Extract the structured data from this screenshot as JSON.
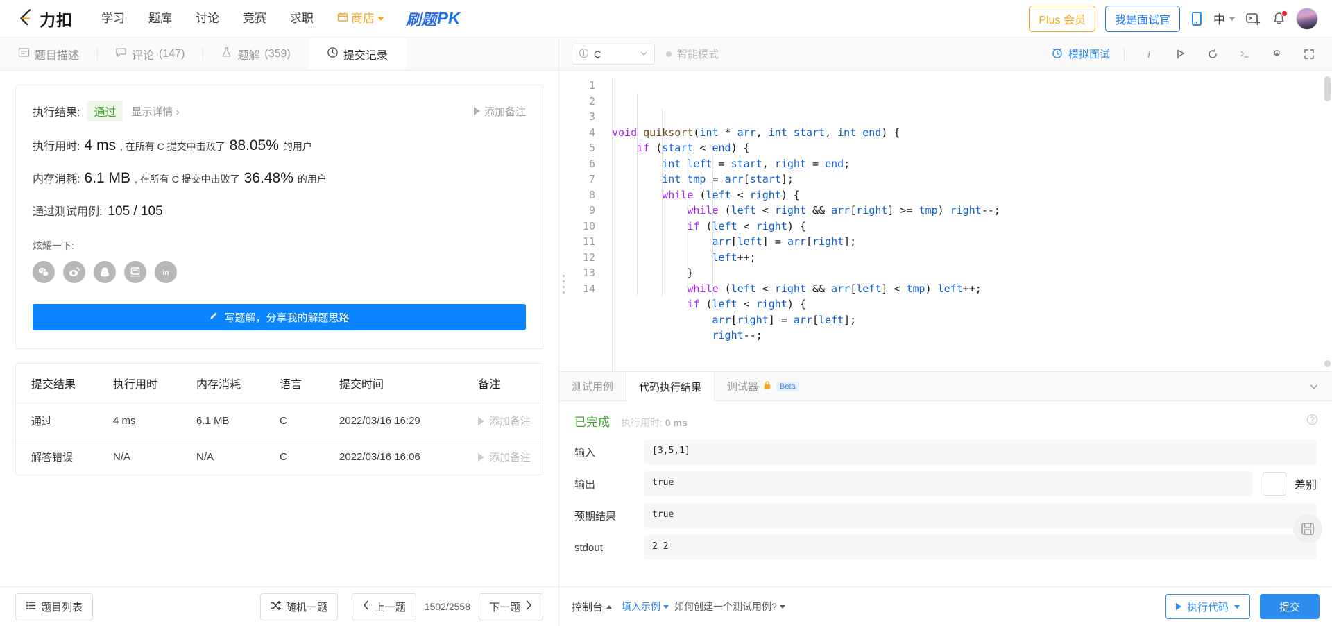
{
  "nav": {
    "brand": "力扣",
    "links": [
      "学习",
      "题库",
      "讨论",
      "竞赛",
      "求职"
    ],
    "shop": "商店",
    "pk_cn": "刷题",
    "pk_en": "PK",
    "plus": "Plus 会员",
    "interviewer": "我是面试官",
    "lang": "中",
    "icons": [
      "mobile-icon",
      "language-icon",
      "terminal-add-icon",
      "bell-icon",
      "avatar"
    ]
  },
  "left_tabs": [
    {
      "label": "题目描述",
      "icon": "description-icon",
      "count": "",
      "active": false
    },
    {
      "label": "评论",
      "icon": "comment-icon",
      "count": "(147)",
      "active": false
    },
    {
      "label": "题解",
      "icon": "flask-icon",
      "count": "(359)",
      "active": false
    },
    {
      "label": "提交记录",
      "icon": "clock-icon",
      "count": "",
      "active": true
    }
  ],
  "result": {
    "exec_label": "执行结果:",
    "status": "通过",
    "show_detail": "显示详情 ›",
    "add_note": "添加备注",
    "runtime_label": "执行用时:",
    "runtime_value": "4 ms",
    "runtime_tail_a": ", 在所有 C 提交中击败了",
    "runtime_percent": "88.05%",
    "runtime_tail_b": "的用户",
    "memory_label": "内存消耗:",
    "memory_value": "6.1 MB",
    "memory_percent": "36.48%",
    "cases_label": "通过测试用例:",
    "cases_value": "105 / 105",
    "share_label": "炫耀一下:",
    "share_icons": [
      "wechat-icon",
      "weibo-icon",
      "qq-icon",
      "douban-icon",
      "linkedin-icon"
    ],
    "write_button": "写题解，分享我的解题思路"
  },
  "submissions": {
    "headers": [
      "提交结果",
      "执行用时",
      "内存消耗",
      "语言",
      "提交时间",
      "备注"
    ],
    "rows": [
      {
        "result": "通过",
        "status": "pass",
        "runtime": "4 ms",
        "memory": "6.1 MB",
        "lang": "C",
        "time": "2022/03/16 16:29",
        "note": "添加备注"
      },
      {
        "result": "解答错误",
        "status": "wrong",
        "runtime": "N/A",
        "memory": "N/A",
        "lang": "C",
        "time": "2022/03/16 16:06",
        "note": "添加备注"
      }
    ]
  },
  "left_footer": {
    "problem_list": "题目列表",
    "random": "随机一题",
    "prev": "上一题",
    "page": "1502/2558",
    "next": "下一题"
  },
  "editor_header": {
    "language": "C",
    "smart_mode": "智能模式",
    "mock_interview": "模拟面试",
    "tools": [
      "info-icon",
      "flag-icon",
      "reset-icon",
      "terminal-icon",
      "settings-icon",
      "fullscreen-icon"
    ]
  },
  "code": {
    "lines": [
      {
        "n": 1,
        "indent": 0,
        "parts": [
          [
            "k1",
            "void"
          ],
          [
            "sp",
            " "
          ],
          [
            "fn",
            "quiksort"
          ],
          [
            "id",
            "("
          ],
          [
            "ty",
            "int"
          ],
          [
            "id",
            " * "
          ],
          [
            "var",
            "arr"
          ],
          [
            "id",
            ", "
          ],
          [
            "ty",
            "int"
          ],
          [
            "id",
            " "
          ],
          [
            "var",
            "start"
          ],
          [
            "id",
            ", "
          ],
          [
            "ty",
            "int"
          ],
          [
            "id",
            " "
          ],
          [
            "var",
            "end"
          ],
          [
            "id",
            ") {"
          ]
        ]
      },
      {
        "n": 2,
        "indent": 1,
        "parts": [
          [
            "k",
            "if"
          ],
          [
            "id",
            " ("
          ],
          [
            "var",
            "start"
          ],
          [
            "id",
            " < "
          ],
          [
            "var",
            "end"
          ],
          [
            "id",
            ") {"
          ]
        ]
      },
      {
        "n": 3,
        "indent": 2,
        "parts": [
          [
            "ty",
            "int"
          ],
          [
            "id",
            " "
          ],
          [
            "var",
            "left"
          ],
          [
            "id",
            " = "
          ],
          [
            "var",
            "start"
          ],
          [
            "id",
            ", "
          ],
          [
            "var",
            "right"
          ],
          [
            "id",
            " = "
          ],
          [
            "var",
            "end"
          ],
          [
            "id",
            ";"
          ]
        ]
      },
      {
        "n": 4,
        "indent": 2,
        "parts": [
          [
            "ty",
            "int"
          ],
          [
            "id",
            " "
          ],
          [
            "var",
            "tmp"
          ],
          [
            "id",
            " = "
          ],
          [
            "var",
            "arr"
          ],
          [
            "id",
            "["
          ],
          [
            "var",
            "start"
          ],
          [
            "id",
            "];"
          ]
        ]
      },
      {
        "n": 5,
        "indent": 2,
        "parts": [
          [
            "k",
            "while"
          ],
          [
            "id",
            " ("
          ],
          [
            "var",
            "left"
          ],
          [
            "id",
            " < "
          ],
          [
            "var",
            "right"
          ],
          [
            "id",
            ") {"
          ]
        ]
      },
      {
        "n": 6,
        "indent": 3,
        "parts": [
          [
            "k",
            "while"
          ],
          [
            "id",
            " ("
          ],
          [
            "var",
            "left"
          ],
          [
            "id",
            " < "
          ],
          [
            "var",
            "right"
          ],
          [
            "id",
            " && "
          ],
          [
            "var",
            "arr"
          ],
          [
            "id",
            "["
          ],
          [
            "var",
            "right"
          ],
          [
            "id",
            "] >= "
          ],
          [
            "var",
            "tmp"
          ],
          [
            "id",
            ") "
          ],
          [
            "var",
            "right"
          ],
          [
            "id",
            "--;"
          ]
        ]
      },
      {
        "n": 7,
        "indent": 3,
        "parts": [
          [
            "k",
            "if"
          ],
          [
            "id",
            " ("
          ],
          [
            "var",
            "left"
          ],
          [
            "id",
            " < "
          ],
          [
            "var",
            "right"
          ],
          [
            "id",
            ") {"
          ]
        ]
      },
      {
        "n": 8,
        "indent": 4,
        "parts": [
          [
            "var",
            "arr"
          ],
          [
            "id",
            "["
          ],
          [
            "var",
            "left"
          ],
          [
            "id",
            "] = "
          ],
          [
            "var",
            "arr"
          ],
          [
            "id",
            "["
          ],
          [
            "var",
            "right"
          ],
          [
            "id",
            "];"
          ]
        ]
      },
      {
        "n": 9,
        "indent": 4,
        "parts": [
          [
            "var",
            "left"
          ],
          [
            "id",
            "++;"
          ]
        ]
      },
      {
        "n": 10,
        "indent": 3,
        "parts": [
          [
            "id",
            "}"
          ]
        ]
      },
      {
        "n": 11,
        "indent": 3,
        "parts": [
          [
            "k",
            "while"
          ],
          [
            "id",
            " ("
          ],
          [
            "var",
            "left"
          ],
          [
            "id",
            " < "
          ],
          [
            "var",
            "right"
          ],
          [
            "id",
            " && "
          ],
          [
            "var",
            "arr"
          ],
          [
            "id",
            "["
          ],
          [
            "var",
            "left"
          ],
          [
            "id",
            "] < "
          ],
          [
            "var",
            "tmp"
          ],
          [
            "id",
            ") "
          ],
          [
            "var",
            "left"
          ],
          [
            "id",
            "++;"
          ]
        ]
      },
      {
        "n": 12,
        "indent": 3,
        "parts": [
          [
            "k",
            "if"
          ],
          [
            "id",
            " ("
          ],
          [
            "var",
            "left"
          ],
          [
            "id",
            " < "
          ],
          [
            "var",
            "right"
          ],
          [
            "id",
            ") {"
          ]
        ]
      },
      {
        "n": 13,
        "indent": 4,
        "parts": [
          [
            "var",
            "arr"
          ],
          [
            "id",
            "["
          ],
          [
            "var",
            "right"
          ],
          [
            "id",
            "] = "
          ],
          [
            "var",
            "arr"
          ],
          [
            "id",
            "["
          ],
          [
            "var",
            "left"
          ],
          [
            "id",
            "];"
          ]
        ]
      },
      {
        "n": 14,
        "indent": 4,
        "parts": [
          [
            "var",
            "right"
          ],
          [
            "id",
            "--;"
          ]
        ]
      }
    ]
  },
  "console": {
    "tabs": [
      {
        "label": "测试用例",
        "active": false
      },
      {
        "label": "代码执行结果",
        "active": true
      },
      {
        "label": "调试器",
        "active": false,
        "lock": "lock-icon",
        "beta": "Beta"
      }
    ],
    "status": "已完成",
    "runtime_label": "执行用时:",
    "runtime_value": "0 ms",
    "fields": [
      {
        "name": "输入",
        "value": "[3,5,1]",
        "has_diff": false
      },
      {
        "name": "输出",
        "value": "true",
        "has_diff": true,
        "diff_label": "差别"
      },
      {
        "name": "预期结果",
        "value": "true",
        "has_diff": false
      },
      {
        "name": "stdout",
        "value": "2 2",
        "has_diff": false
      }
    ]
  },
  "right_footer": {
    "console": "控制台",
    "fill_example": "填入示例",
    "how_to": "如何创建一个测试用例?",
    "run": "执行代码",
    "submit": "提交"
  },
  "colors": {
    "accent_blue": "#2d8cf0",
    "brand_blue": "#0a84ff",
    "orange": "#f5a623",
    "pass_green": "#3fa02e",
    "error_red": "#ef4743"
  }
}
